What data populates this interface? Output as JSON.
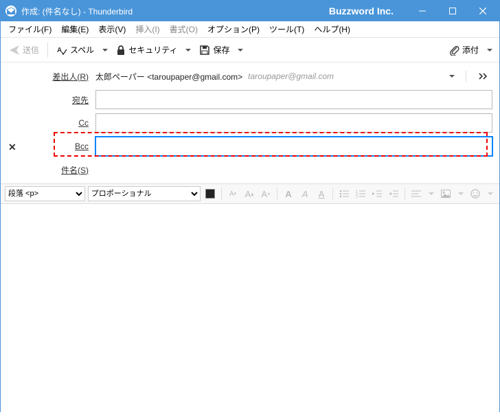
{
  "window": {
    "title": "作成: (件名なし) - Thunderbird",
    "brand": "Buzzword Inc."
  },
  "menubar": {
    "file": "ファイル(F)",
    "edit": "編集(E)",
    "view": "表示(V)",
    "insert": "挿入(I)",
    "format": "書式(O)",
    "options": "オプション(P)",
    "tools": "ツール(T)",
    "help": "ヘルプ(H)"
  },
  "toolbar": {
    "send": "送信",
    "spell": "スペル",
    "security": "セキュリティ",
    "save": "保存",
    "attach": "添付"
  },
  "headers": {
    "from_label": "差出人(R)",
    "from_name": "太郎ペーパー <taroupaper@gmail.com>",
    "from_email_display": "taroupaper@gmail.com",
    "to_label": "宛先",
    "to_value": "",
    "cc_label": "Cc",
    "cc_value": "",
    "bcc_label": "Bcc",
    "bcc_value": "",
    "subject_label": "件名(S)",
    "subject_value": ""
  },
  "format_toolbar": {
    "paragraph": "段落 <p>",
    "font": "プロポーショナル"
  }
}
